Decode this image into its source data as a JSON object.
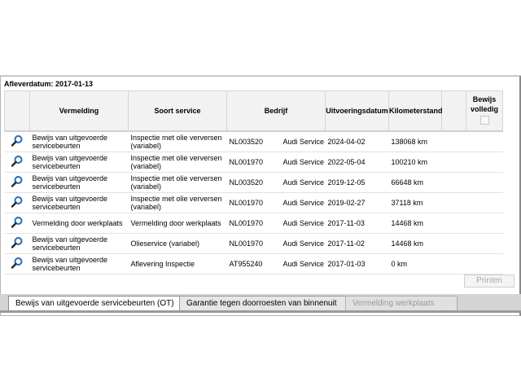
{
  "heading": "Afleverdatum: 2017-01-13",
  "columns": {
    "vermelding": "Vermelding",
    "soort": "Soort service",
    "bedrijf": "Bedrijf",
    "datum": "Uitvoeringsdatum",
    "km": "Kilometerstand",
    "bewijs_line1": "Bewijs",
    "bewijs_line2": "volledig"
  },
  "rows": [
    {
      "vermelding": "Bewijs van uitgevoerde servicebeurten",
      "soort": "Inspectie met olie verversen (variabel)",
      "code": "NL003520",
      "bedrijf": "Audi Service",
      "datum": "2024-04-02",
      "km": "138068 km"
    },
    {
      "vermelding": "Bewijs van uitgevoerde servicebeurten",
      "soort": "Inspectie met olie verversen (variabel)",
      "code": "NL001970",
      "bedrijf": "Audi Service",
      "datum": "2022-05-04",
      "km": "100210 km"
    },
    {
      "vermelding": "Bewijs van uitgevoerde servicebeurten",
      "soort": "Inspectie met olie verversen (variabel)",
      "code": "NL003520",
      "bedrijf": "Audi Service",
      "datum": "2019-12-05",
      "km": "66648 km"
    },
    {
      "vermelding": "Bewijs van uitgevoerde servicebeurten",
      "soort": "Inspectie met olie verversen (variabel)",
      "code": "NL001970",
      "bedrijf": "Audi Service",
      "datum": "2019-02-27",
      "km": "37118 km"
    },
    {
      "vermelding": "Vermelding door werkplaats",
      "soort": "Vermelding door werkplaats",
      "code": "NL001970",
      "bedrijf": "Audi Service",
      "datum": "2017-11-03",
      "km": "14468 km"
    },
    {
      "vermelding": "Bewijs van uitgevoerde servicebeurten",
      "soort": "Olieservice (variabel)",
      "code": "NL001970",
      "bedrijf": "Audi Service",
      "datum": "2017-11-02",
      "km": "14468 km"
    },
    {
      "vermelding": "Bewijs van uitgevoerde servicebeurten",
      "soort": "Aflevering Inspectie",
      "code": "AT955240",
      "bedrijf": "Audi Service",
      "datum": "2017-01-03",
      "km": "0 km"
    }
  ],
  "print_label": "Printen",
  "tabs": [
    "Bewijs van uitgevoerde servicebeurten (OT)",
    "Garantie tegen doorroesten van binnenuit",
    "Vermelding werkplaats"
  ],
  "colors": {
    "icon_blue": "#1f6fb8",
    "icon_handle": "#2a2a2a"
  }
}
